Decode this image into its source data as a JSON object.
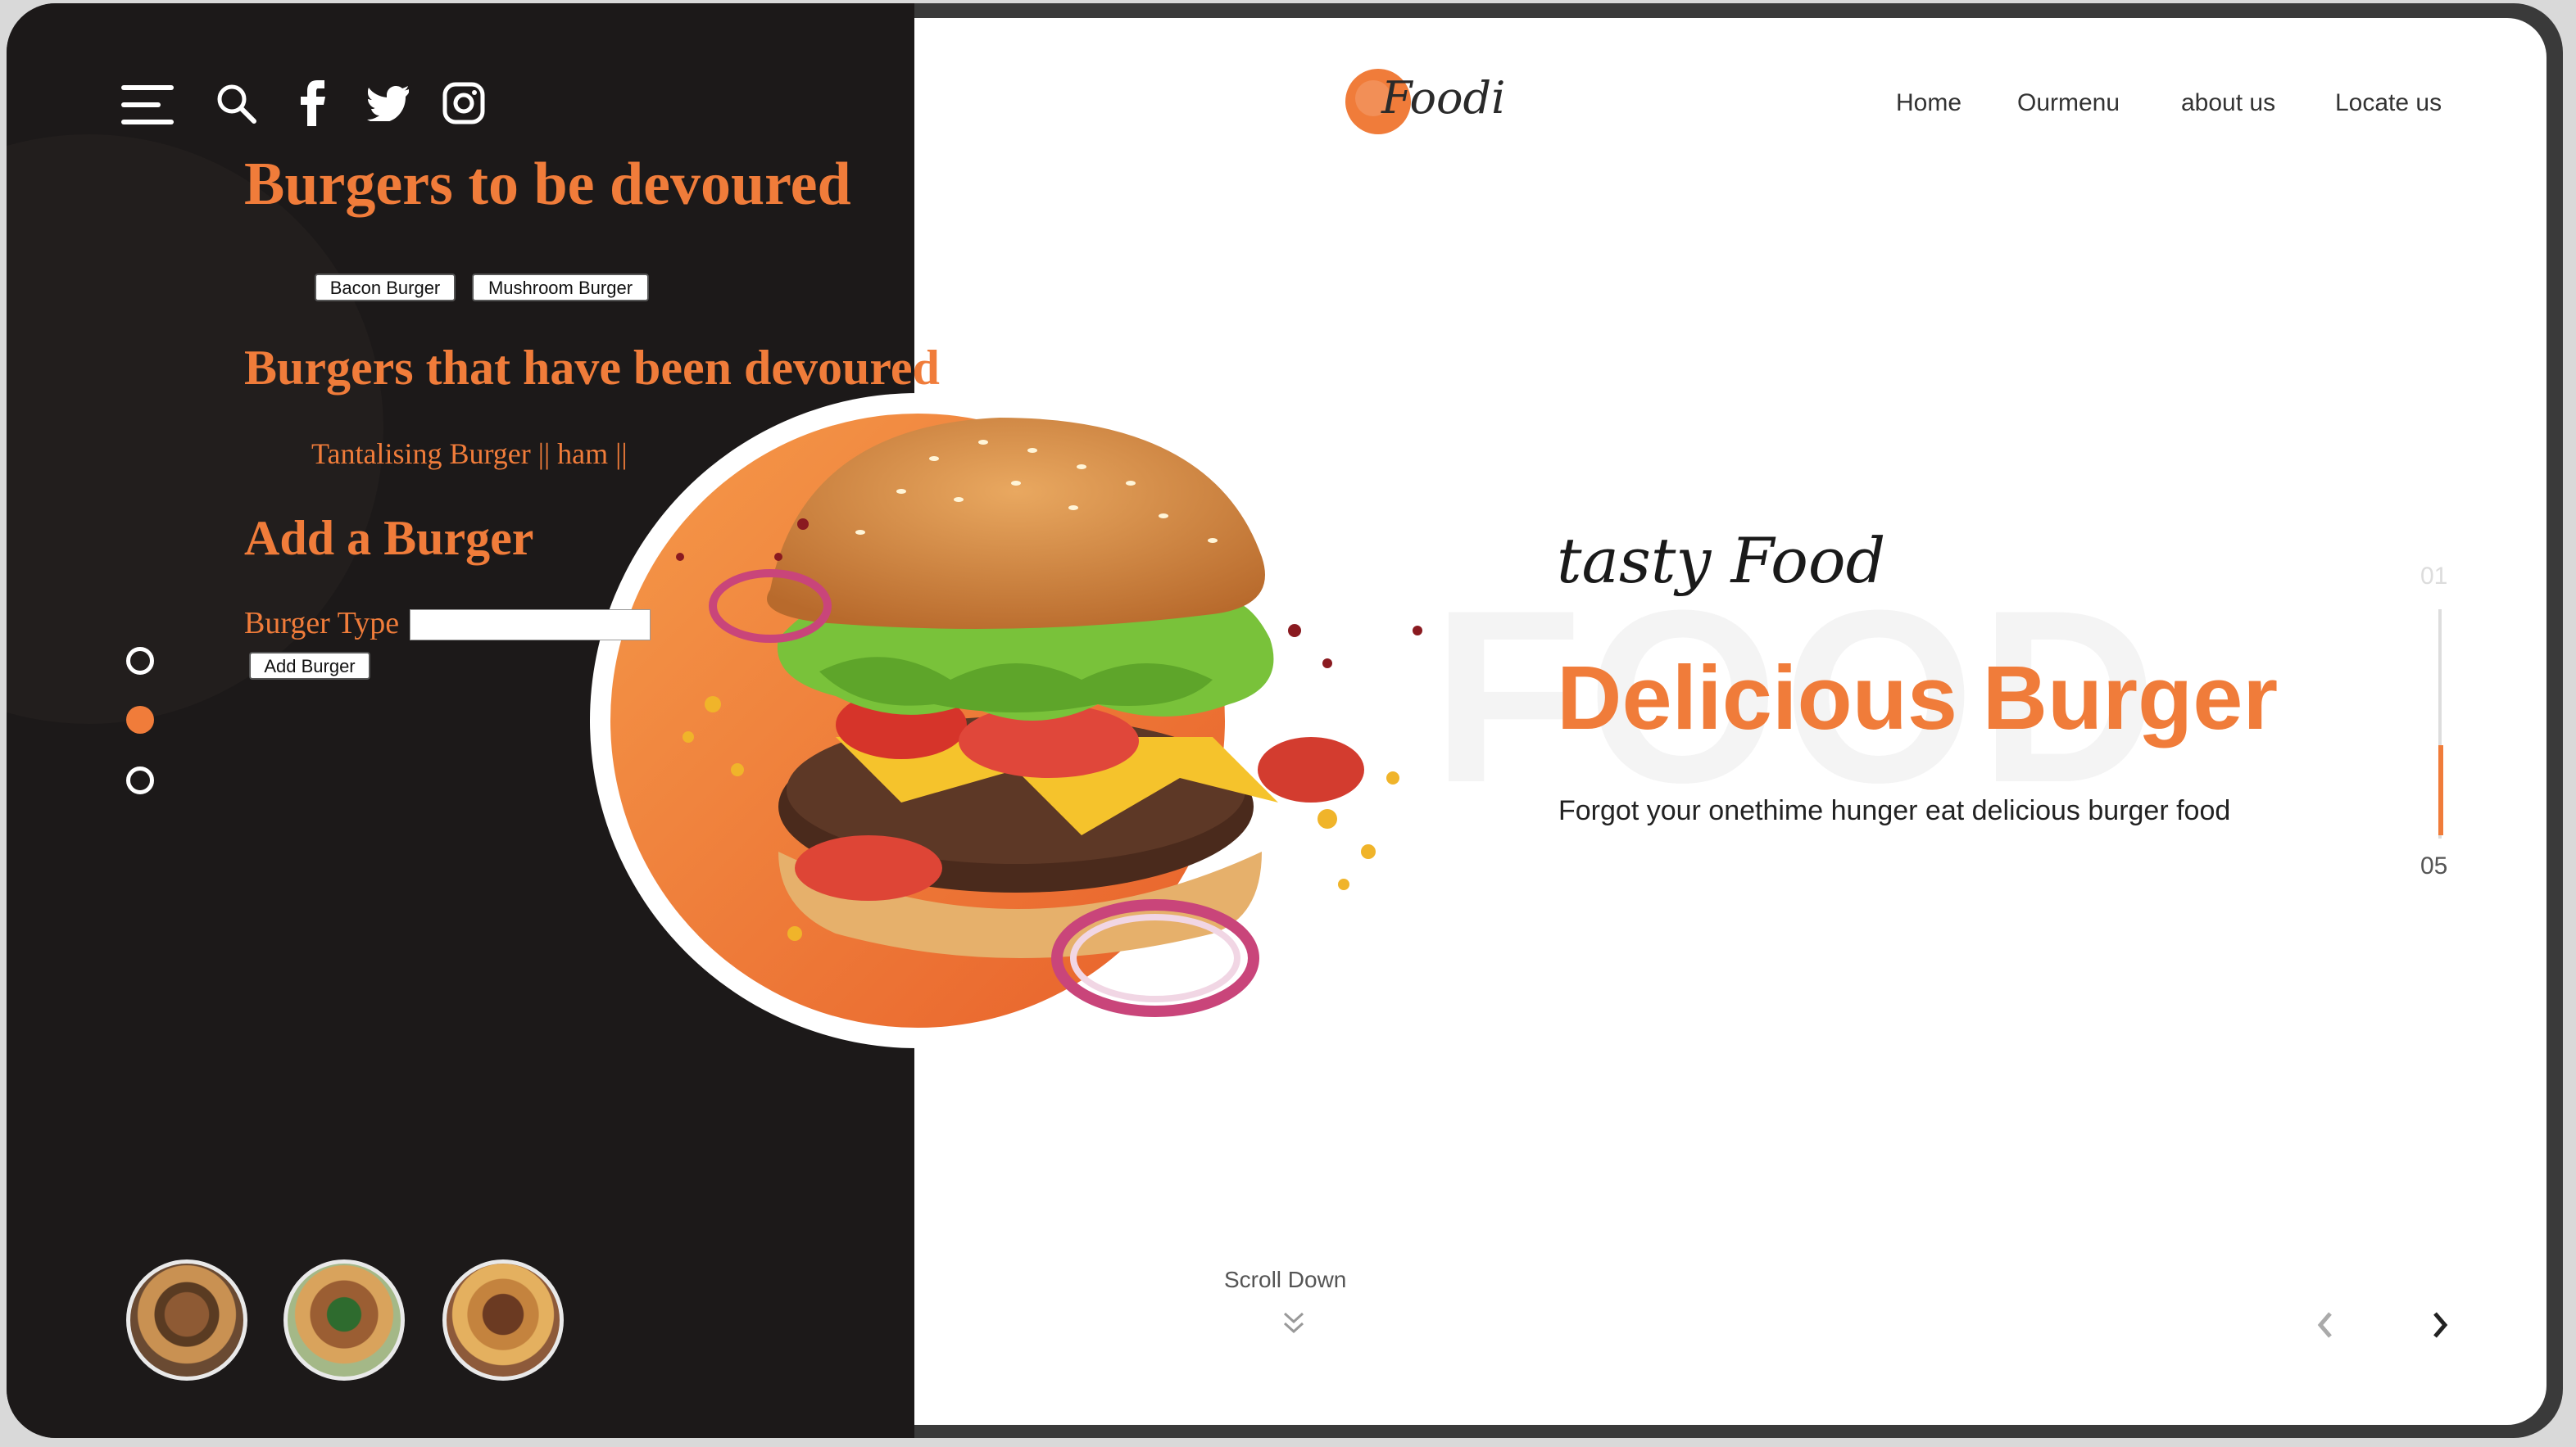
{
  "app": {
    "brand": "Foodi",
    "nav": [
      "Home",
      "Ourmenu",
      "about us",
      "Locate us"
    ]
  },
  "sidebar": {
    "icons": [
      "menu-icon",
      "search-icon",
      "facebook-icon",
      "twitter-icon",
      "instagram-icon"
    ],
    "slider_dots": [
      {
        "state": "inactive"
      },
      {
        "state": "active"
      },
      {
        "state": "inactive"
      }
    ],
    "thumbnails": [
      "burger-thumb-1",
      "burger-thumb-2",
      "burger-thumb-3"
    ]
  },
  "devour": {
    "heading": "Burgers to be devoured",
    "items": [
      "Bacon Burger",
      "Mushroom Burger"
    ],
    "devoured_heading": "Burgers that have been devoured",
    "devoured_items_text": "Tantalising Burger || ham ||",
    "add_heading": "Add a Burger",
    "type_label": "Burger Type",
    "type_value": "",
    "add_button": "Add Burger"
  },
  "hero": {
    "background_word": "FOOD",
    "script_title": "tasty Food",
    "title": "Delicious Burger",
    "subtitle": "Forgot your onethime hunger eat delicious burger food",
    "counter_current": "01",
    "counter_total": "05",
    "scroll_label": "Scroll Down"
  },
  "colors": {
    "accent": "#f07c3a",
    "sidebar_bg": "#1c1919",
    "content_bg": "#ffffff"
  }
}
